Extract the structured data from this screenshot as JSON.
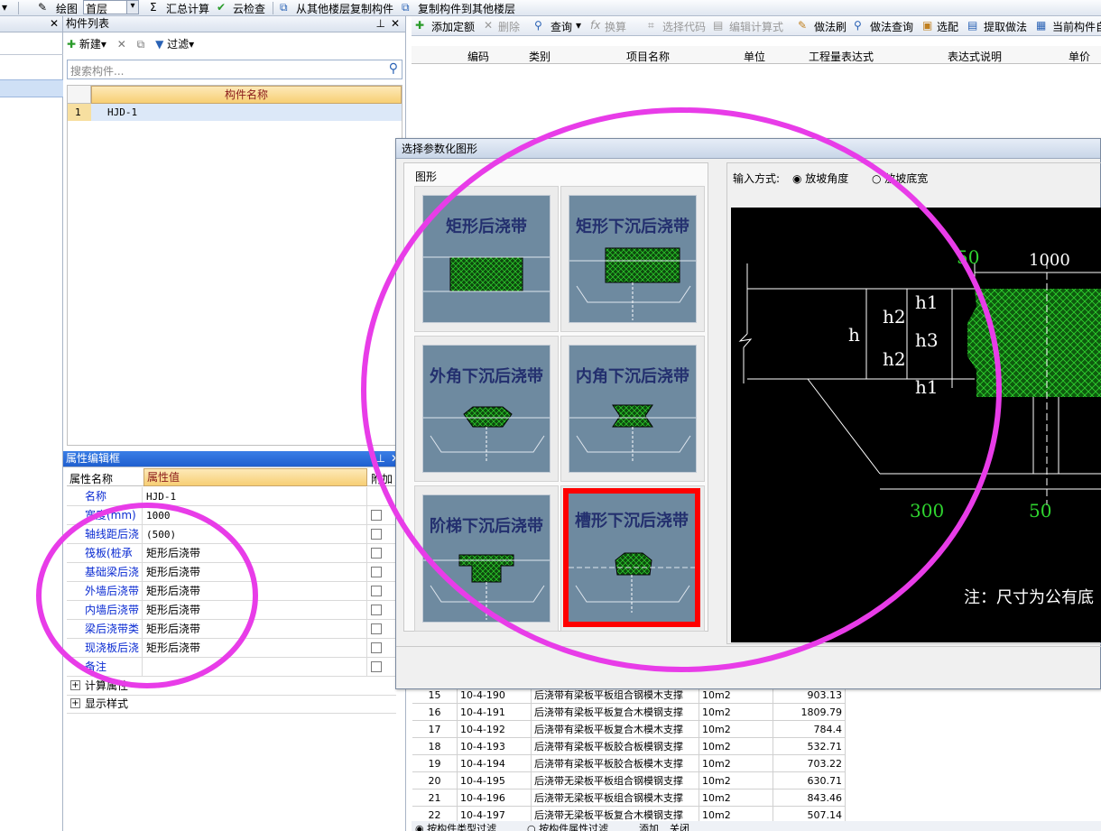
{
  "toolbar": {
    "draw_label": "绘图",
    "floor_value": "首层",
    "sum_label": "汇总计算",
    "cloud_check_label": "云检查",
    "copy_from_label": "从其他楼层复制构件",
    "copy_to_label": "复制构件到其他楼层"
  },
  "component_list": {
    "title": "构件列表",
    "new_label": "新建",
    "filter_label": "过滤",
    "search_placeholder": "搜索构件...",
    "column_header": "构件名称",
    "rows": [
      {
        "index": "1",
        "name": "HJD-1"
      }
    ]
  },
  "property_editor": {
    "title": "属性编辑框",
    "col_name": "属性名称",
    "col_value": "属性值",
    "col_extra": "附加",
    "rows": [
      {
        "name": "名称",
        "value": "HJD-1"
      },
      {
        "name": "宽度(mm)",
        "value": "1000"
      },
      {
        "name": "轴线距后浇",
        "value": "(500)"
      },
      {
        "name": "筏板(桩承",
        "value": "矩形后浇带"
      },
      {
        "name": "基础梁后浇",
        "value": "矩形后浇带"
      },
      {
        "name": "外墙后浇带",
        "value": "矩形后浇带"
      },
      {
        "name": "内墙后浇带",
        "value": "矩形后浇带"
      },
      {
        "name": "梁后浇带类",
        "value": "矩形后浇带"
      },
      {
        "name": "现浇板后浇",
        "value": "矩形后浇带"
      },
      {
        "name": "备注",
        "value": ""
      }
    ],
    "groups": [
      "计算属性",
      "显示样式"
    ]
  },
  "right_toolbar": {
    "add_quota": "添加定额",
    "delete": "删除",
    "query": "查询",
    "convert": "换算",
    "select_code": "选择代码",
    "edit_formula": "编辑计算式",
    "method_brush": "做法刷",
    "method_query": "做法查询",
    "select_match": "选配",
    "extract_method": "提取做法",
    "current_component": "当前构件自"
  },
  "quota_table": {
    "headers": [
      "编码",
      "类别",
      "项目名称",
      "单位",
      "工程量表达式",
      "表达式说明",
      "单价"
    ],
    "rows": [
      {
        "idx": "15",
        "code": "10-4-190",
        "name": "后浇带有梁板平板组合钢模木支撑",
        "unit": "10m2",
        "price": "903.13"
      },
      {
        "idx": "16",
        "code": "10-4-191",
        "name": "后浇带有梁板平板复合木模钢支撑",
        "unit": "10m2",
        "price": "1809.79"
      },
      {
        "idx": "17",
        "code": "10-4-192",
        "name": "后浇带有梁板平板复合木模木支撑",
        "unit": "10m2",
        "price": "784.4"
      },
      {
        "idx": "18",
        "code": "10-4-193",
        "name": "后浇带有梁板平板胶合板模钢支撑",
        "unit": "10m2",
        "price": "532.71"
      },
      {
        "idx": "19",
        "code": "10-4-194",
        "name": "后浇带有梁板平板胶合板模木支撑",
        "unit": "10m2",
        "price": "703.22"
      },
      {
        "idx": "20",
        "code": "10-4-195",
        "name": "后浇带无梁板平板组合钢模钢支撑",
        "unit": "10m2",
        "price": "630.71"
      },
      {
        "idx": "21",
        "code": "10-4-196",
        "name": "后浇带无梁板平板组合钢模木支撑",
        "unit": "10m2",
        "price": "843.46"
      },
      {
        "idx": "22",
        "code": "10-4-197",
        "name": "后浇带无梁板平板复合木模钢支撑",
        "unit": "10m2",
        "price": "507.14"
      }
    ]
  },
  "bottom_tabs": [
    "按构件类型过滤",
    "按构件属性过滤",
    "添加",
    "关闭"
  ],
  "dialog": {
    "title": "选择参数化图形",
    "group_label": "图形",
    "input_mode_label": "输入方式:",
    "option_angle": "放坡角度",
    "option_width": "放坡底宽",
    "shapes": [
      "矩形后浇带",
      "矩形下沉后浇带",
      "外角下沉后浇带",
      "内角下沉后浇带",
      "阶梯下沉后浇带",
      "槽形下沉后浇带"
    ],
    "selected_shape": "槽形下沉后浇带",
    "cad": {
      "dim_50_top": "50",
      "dim_1000": "1000",
      "h": "h",
      "h1": "h1",
      "h2": "h2",
      "h3": "h3",
      "dim_300": "300",
      "dim_50_bottom": "50",
      "note": "注：尺寸为公有底"
    }
  },
  "colors": {
    "highlight_circle": "#e83ce8",
    "selection": "#ff0000",
    "cad_green": "#2fd42f"
  }
}
